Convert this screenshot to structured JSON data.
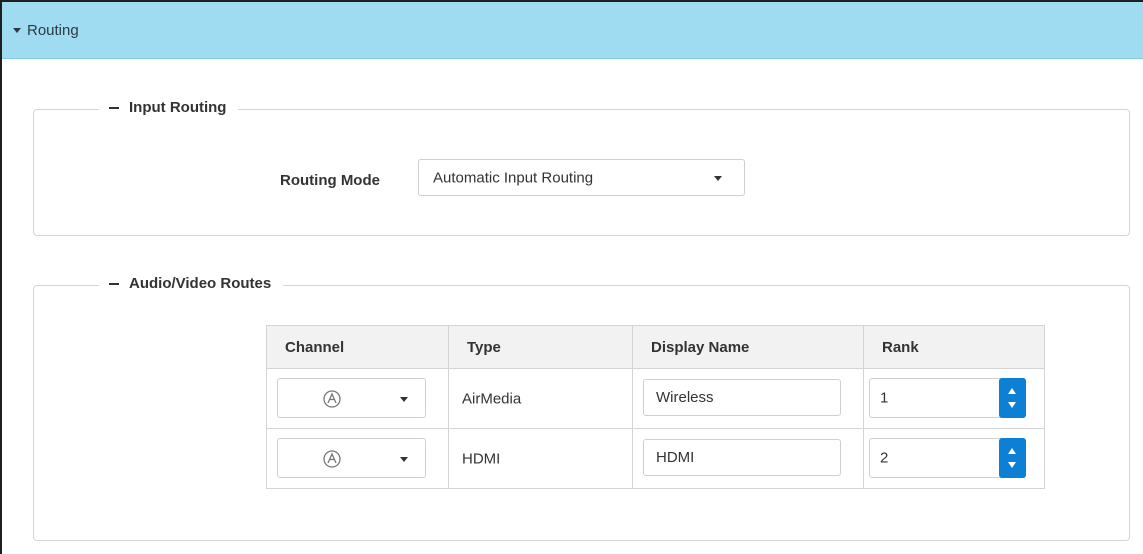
{
  "header": {
    "title": "Routing"
  },
  "input_routing": {
    "legend": "Input Routing",
    "routing_mode_label": "Routing Mode",
    "routing_mode_value": "Automatic Input Routing"
  },
  "av_routes": {
    "legend": "Audio/Video Routes",
    "columns": [
      "Channel",
      "Type",
      "Display Name",
      "Rank"
    ],
    "rows": [
      {
        "channel_icon": "airmedia-icon",
        "type": "AirMedia",
        "display_name": "Wireless",
        "rank": "1"
      },
      {
        "channel_icon": "airmedia-icon",
        "type": "HDMI",
        "display_name": "HDMI",
        "rank": "2"
      }
    ]
  },
  "colors": {
    "header_bg": "#9fdcf2",
    "spinner_bg": "#0d7fd4"
  }
}
